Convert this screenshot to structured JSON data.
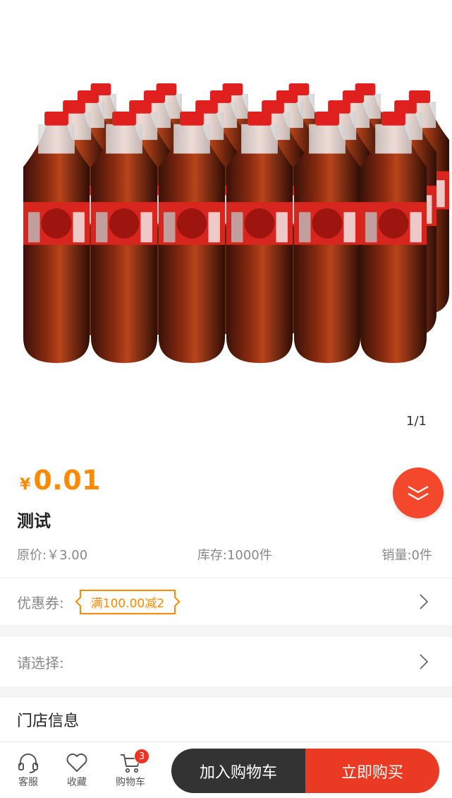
{
  "product": {
    "image_alt": "可口可乐 瓶装汽水 组图",
    "pager": "1/1",
    "price_symbol": "¥",
    "price": "0.01",
    "title": "测试",
    "original_price": "原价:￥3.00",
    "stock": "库存:1000件",
    "sales": "销量:0件"
  },
  "coupon": {
    "label": "优惠券:",
    "tag": "满100.00减2"
  },
  "select": {
    "label": "请选择:"
  },
  "store": {
    "label": "门店信息"
  },
  "bottom_bar": {
    "service_label": "客服",
    "favorite_label": "收藏",
    "cart_label": "购物车",
    "cart_count": "3",
    "add_to_cart": "加入购物车",
    "buy_now": "立即购买"
  },
  "colors": {
    "accent": "#ff8a00",
    "buy": "#ea3a24",
    "dark": "#333333",
    "fab": "#f4482c"
  },
  "icons": [
    "headset-icon",
    "heart-icon",
    "cart-icon",
    "chevron-right-icon",
    "double-chevron-down-icon"
  ]
}
